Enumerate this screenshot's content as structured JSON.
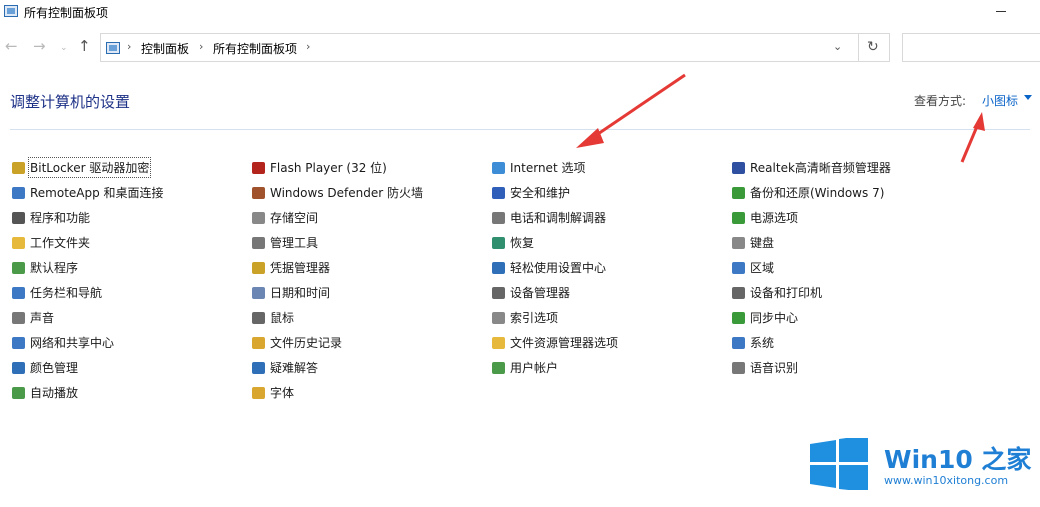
{
  "window": {
    "title": "所有控制面板项"
  },
  "nav": {
    "breadcrumbs": [
      "控制面板",
      "所有控制面板项"
    ],
    "back_icon": "←",
    "forward_icon": "→",
    "recent_icon": "⌄",
    "up_icon": "↑",
    "dropdown_icon": "⌄",
    "refresh_icon": "↻",
    "separator": "›"
  },
  "header": {
    "title": "调整计算机的设置",
    "view_label": "查看方式:",
    "view_mode": "小图标"
  },
  "columns": [
    [
      {
        "label": "BitLocker 驱动器加密",
        "icon": "bitlocker-key-icon",
        "color": "#c9a227",
        "focused": true
      },
      {
        "label": "RemoteApp 和桌面连接",
        "icon": "remoteapp-icon",
        "color": "#3c78c3"
      },
      {
        "label": "程序和功能",
        "icon": "programs-icon",
        "color": "#555555"
      },
      {
        "label": "工作文件夹",
        "icon": "work-folders-icon",
        "color": "#e6b93c"
      },
      {
        "label": "默认程序",
        "icon": "default-programs-icon",
        "color": "#4a9a4a"
      },
      {
        "label": "任务栏和导航",
        "icon": "taskbar-icon",
        "color": "#3c78c3"
      },
      {
        "label": "声音",
        "icon": "sound-icon",
        "color": "#777777"
      },
      {
        "label": "网络和共享中心",
        "icon": "network-icon",
        "color": "#3c78c3"
      },
      {
        "label": "颜色管理",
        "icon": "color-management-icon",
        "color": "#2f6fb8"
      },
      {
        "label": "自动播放",
        "icon": "autoplay-icon",
        "color": "#4a9a4a"
      }
    ],
    [
      {
        "label": "Flash Player (32 位)",
        "icon": "flash-player-icon",
        "color": "#b3241c"
      },
      {
        "label": "Windows Defender 防火墙",
        "icon": "firewall-icon",
        "color": "#a0522d"
      },
      {
        "label": "存储空间",
        "icon": "storage-spaces-icon",
        "color": "#888888"
      },
      {
        "label": "管理工具",
        "icon": "admin-tools-icon",
        "color": "#777777"
      },
      {
        "label": "凭据管理器",
        "icon": "credential-manager-icon",
        "color": "#c9a227"
      },
      {
        "label": "日期和时间",
        "icon": "date-time-icon",
        "color": "#6b86b3"
      },
      {
        "label": "鼠标",
        "icon": "mouse-icon",
        "color": "#666666"
      },
      {
        "label": "文件历史记录",
        "icon": "file-history-icon",
        "color": "#d9a630"
      },
      {
        "label": "疑难解答",
        "icon": "troubleshooting-icon",
        "color": "#2f6fb8"
      },
      {
        "label": "字体",
        "icon": "fonts-icon",
        "color": "#d9a630"
      }
    ],
    [
      {
        "label": "Internet 选项",
        "icon": "internet-options-icon",
        "color": "#3c8dd6"
      },
      {
        "label": "安全和维护",
        "icon": "security-flag-icon",
        "color": "#2f5fb8"
      },
      {
        "label": "电话和调制解调器",
        "icon": "phone-modem-icon",
        "color": "#777777"
      },
      {
        "label": "恢复",
        "icon": "recovery-icon",
        "color": "#2f8f6f"
      },
      {
        "label": "轻松使用设置中心",
        "icon": "ease-of-access-icon",
        "color": "#2f6fb8"
      },
      {
        "label": "设备管理器",
        "icon": "device-manager-icon",
        "color": "#666666"
      },
      {
        "label": "索引选项",
        "icon": "indexing-icon",
        "color": "#888888"
      },
      {
        "label": "文件资源管理器选项",
        "icon": "explorer-options-icon",
        "color": "#e6b93c"
      },
      {
        "label": "用户帐户",
        "icon": "user-accounts-icon",
        "color": "#4a9a4a"
      }
    ],
    [
      {
        "label": "Realtek高清晰音频管理器",
        "icon": "realtek-audio-icon",
        "color": "#2f4fa0"
      },
      {
        "label": "备份和还原(Windows 7)",
        "icon": "backup-restore-icon",
        "color": "#3a9a3a"
      },
      {
        "label": "电源选项",
        "icon": "power-options-icon",
        "color": "#3a9a3a"
      },
      {
        "label": "键盘",
        "icon": "keyboard-icon",
        "color": "#888888"
      },
      {
        "label": "区域",
        "icon": "region-icon",
        "color": "#3c78c3"
      },
      {
        "label": "设备和打印机",
        "icon": "printer-icon",
        "color": "#666666"
      },
      {
        "label": "同步中心",
        "icon": "sync-center-icon",
        "color": "#3a9a3a"
      },
      {
        "label": "系统",
        "icon": "system-icon",
        "color": "#3c78c3"
      },
      {
        "label": "语音识别",
        "icon": "speech-recognition-icon",
        "color": "#777777"
      }
    ]
  ],
  "annotation": {
    "arrow_color": "#e53935"
  },
  "watermark": {
    "brand": "Win10 之家",
    "url": "www.win10xitong.com",
    "logo_color": "#1f8fe0"
  }
}
